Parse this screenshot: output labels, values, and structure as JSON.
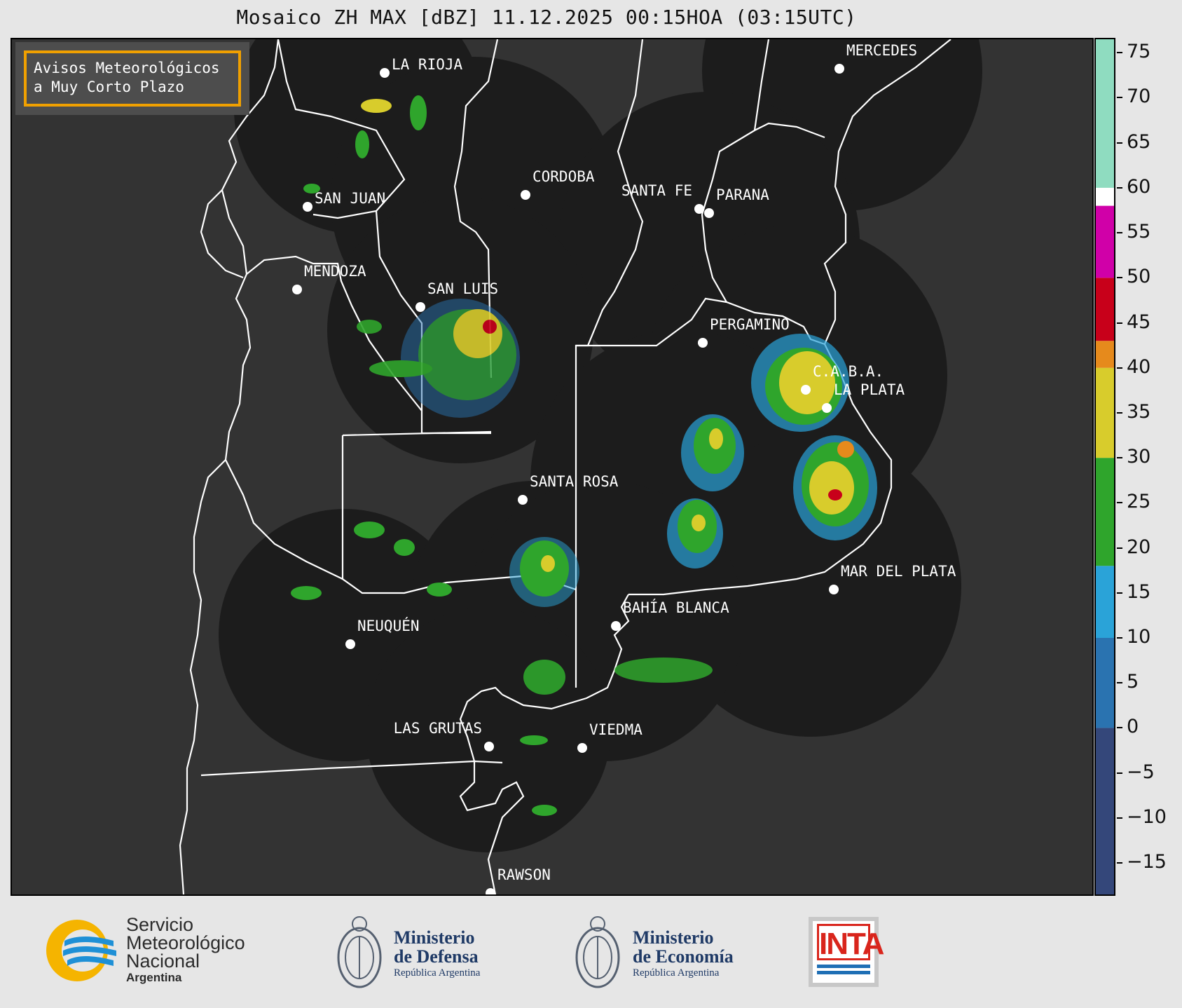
{
  "title": "Mosaico ZH MAX [dBZ] 11.12.2025 00:15HOA (03:15UTC)",
  "badge": {
    "line1": "Avisos Meteorológicos",
    "line2": "a Muy Corto Plazo"
  },
  "colors": {
    "map_background": "#333333",
    "radar_coverage": "#1c1c1c",
    "borders": "#ffffff",
    "badge_border": "#f0a000"
  },
  "cities": [
    {
      "name": "LA RIOJA"
    },
    {
      "name": "SAN JUAN"
    },
    {
      "name": "CORDOBA"
    },
    {
      "name": "SANTA FE"
    },
    {
      "name": "PARANA"
    },
    {
      "name": "MERCEDES"
    },
    {
      "name": "MENDOZA"
    },
    {
      "name": "SAN LUIS"
    },
    {
      "name": "PERGAMINO"
    },
    {
      "name": "C.A.B.A."
    },
    {
      "name": "LA PLATA"
    },
    {
      "name": "SANTA ROSA"
    },
    {
      "name": "MAR DEL PLATA"
    },
    {
      "name": "BAHÍA BLANCA"
    },
    {
      "name": "NEUQUÉN"
    },
    {
      "name": "LAS GRUTAS"
    },
    {
      "name": "VIEDMA"
    },
    {
      "name": "RAWSON"
    }
  ],
  "colorbar": {
    "unit": "dBZ",
    "ticks": [
      "75",
      "70",
      "65",
      "60",
      "55",
      "50",
      "45",
      "40",
      "35",
      "30",
      "25",
      "20",
      "15",
      "10",
      "5",
      "0",
      "−5",
      "−10",
      "−15"
    ],
    "range": [
      -18.5,
      76.5
    ],
    "bands": [
      {
        "from": -18.5,
        "to": 0,
        "color": "#34477a"
      },
      {
        "from": 0,
        "to": 10,
        "color": "#2a73b0"
      },
      {
        "from": 10,
        "to": 18,
        "color": "#2aa3d8"
      },
      {
        "from": 18,
        "to": 30,
        "color": "#2fa52c"
      },
      {
        "from": 30,
        "to": 40,
        "color": "#d8cc2c"
      },
      {
        "from": 40,
        "to": 43,
        "color": "#e68a1c"
      },
      {
        "from": 43,
        "to": 50,
        "color": "#c8001a"
      },
      {
        "from": 50,
        "to": 58,
        "color": "#d000a8"
      },
      {
        "from": 58,
        "to": 60,
        "color": "#ffffff"
      },
      {
        "from": 60,
        "to": 76.5,
        "color": "#8fdcc0"
      }
    ]
  },
  "footer": {
    "smn": {
      "line1": "Servicio",
      "line2": "Meteorológico",
      "line3": "Nacional",
      "line4": "Argentina"
    },
    "defensa": {
      "line1": "Ministerio",
      "line2": "de Defensa",
      "line3": "República Argentina"
    },
    "economia": {
      "line1": "Ministerio",
      "line2": "de Economía",
      "line3": "República Argentina"
    },
    "inta": {
      "label": "INTA"
    }
  }
}
